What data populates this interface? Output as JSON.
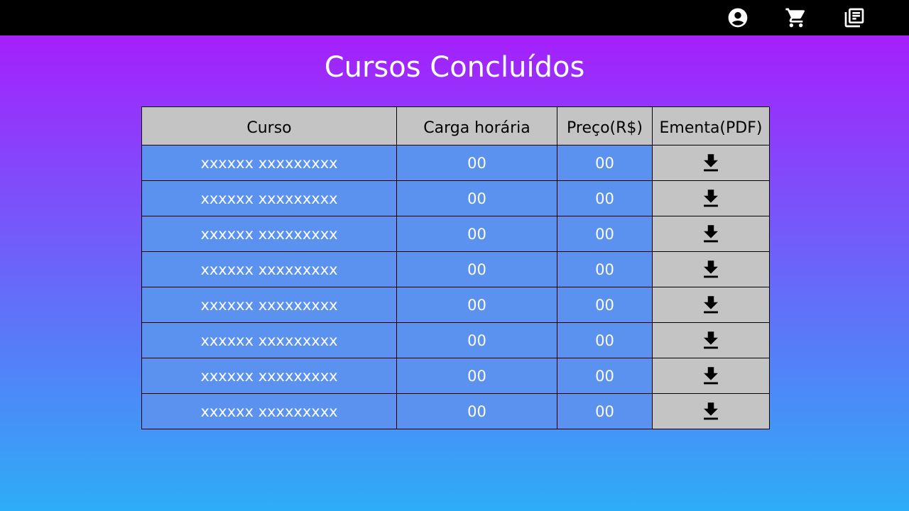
{
  "topbar": {
    "icons": [
      "account-circle-icon",
      "shopping-cart-icon",
      "library-books-icon"
    ]
  },
  "page": {
    "title": "Cursos Concluídos"
  },
  "table": {
    "headers": {
      "curso": "Curso",
      "carga": "Carga horária",
      "preco": "Preço(R$)",
      "ementa": "Ementa(PDF)"
    },
    "rows": [
      {
        "curso": "xxxxxx xxxxxxxxx",
        "carga": "00",
        "preco": "00",
        "ementa_icon": "download-icon"
      },
      {
        "curso": "xxxxxx xxxxxxxxx",
        "carga": "00",
        "preco": "00",
        "ementa_icon": "download-icon"
      },
      {
        "curso": "xxxxxx xxxxxxxxx",
        "carga": "00",
        "preco": "00",
        "ementa_icon": "download-icon"
      },
      {
        "curso": "xxxxxx xxxxxxxxx",
        "carga": "00",
        "preco": "00",
        "ementa_icon": "download-icon"
      },
      {
        "curso": "xxxxxx xxxxxxxxx",
        "carga": "00",
        "preco": "00",
        "ementa_icon": "download-icon"
      },
      {
        "curso": "xxxxxx xxxxxxxxx",
        "carga": "00",
        "preco": "00",
        "ementa_icon": "download-icon"
      },
      {
        "curso": "xxxxxx xxxxxxxxx",
        "carga": "00",
        "preco": "00",
        "ementa_icon": "download-icon"
      },
      {
        "curso": "xxxxxx xxxxxxxxx",
        "carga": "00",
        "preco": "00",
        "ementa_icon": "download-icon"
      }
    ]
  },
  "colors": {
    "topbar": "#000000",
    "gradient_top": "#ae15fd",
    "gradient_bottom": "#2eadf6",
    "header_cell": "#c4c4c4",
    "body_cell": "#5b92f0",
    "download_cell": "#c4c4c4"
  }
}
